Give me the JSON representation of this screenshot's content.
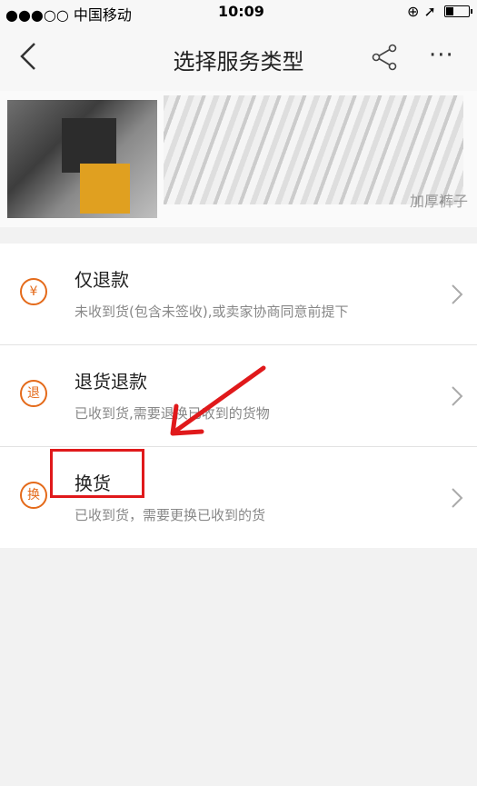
{
  "status_bar": {
    "carrier": "●●●○○ 中国移动",
    "time": "10:09",
    "right_icons": "⊕ ➚"
  },
  "nav": {
    "title": "选择服务类型",
    "more": "···"
  },
  "product": {
    "title": "加厚裤子"
  },
  "options": [
    {
      "icon": "¥",
      "title": "仅退款",
      "desc": "未收到货(包含未签收),或卖家协商同意前提下"
    },
    {
      "icon": "退",
      "title": "退货退款",
      "desc": "已收到货,需要退换已收到的货物"
    },
    {
      "icon": "换",
      "title": "换货",
      "desc": "已收到货，需要更换已收到的货"
    }
  ],
  "colors": {
    "accent": "#e46a1a",
    "annotation": "#e0191b"
  }
}
